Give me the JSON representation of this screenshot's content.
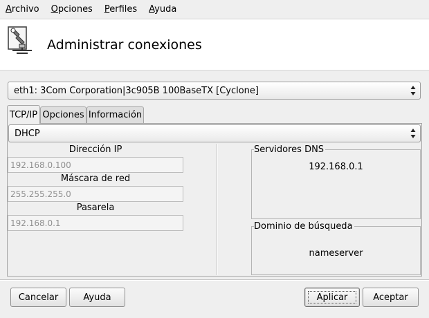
{
  "menu": {
    "items": [
      {
        "first": "A",
        "rest": "rchivo"
      },
      {
        "first": "O",
        "rest": "pciones"
      },
      {
        "first": "P",
        "rest": "erfiles"
      },
      {
        "first": "A",
        "rest": "yuda"
      }
    ]
  },
  "header": {
    "title": "Administrar conexiones",
    "icon": "network-tool-icon"
  },
  "interface_select": {
    "value": "eth1: 3Com Corporation|3c905B 100BaseTX [Cyclone]"
  },
  "tabs": [
    {
      "label": "TCP/IP",
      "active": true
    },
    {
      "label": "Opciones",
      "active": false
    },
    {
      "label": "Información",
      "active": false
    }
  ],
  "tcpip": {
    "mode": "DHCP",
    "ip_label": "Dirección IP",
    "ip_value": "192.168.0.100",
    "mask_label": "Máscara de red",
    "mask_value": "255.255.255.0",
    "gateway_label": "Pasarela",
    "gateway_value": "192.168.0.1",
    "dns_title": "Servidores DNS",
    "dns_value": "192.168.0.1",
    "domain_title": "Dominio de búsqueda",
    "domain_value": "nameserver"
  },
  "buttons": {
    "cancel": "Cancelar",
    "help": "Ayuda",
    "apply": "Aplicar",
    "accept": "Aceptar"
  },
  "colors": {
    "window_bg": "#efefef",
    "header_bg": "#ffffff",
    "disabled_text": "#909090"
  }
}
